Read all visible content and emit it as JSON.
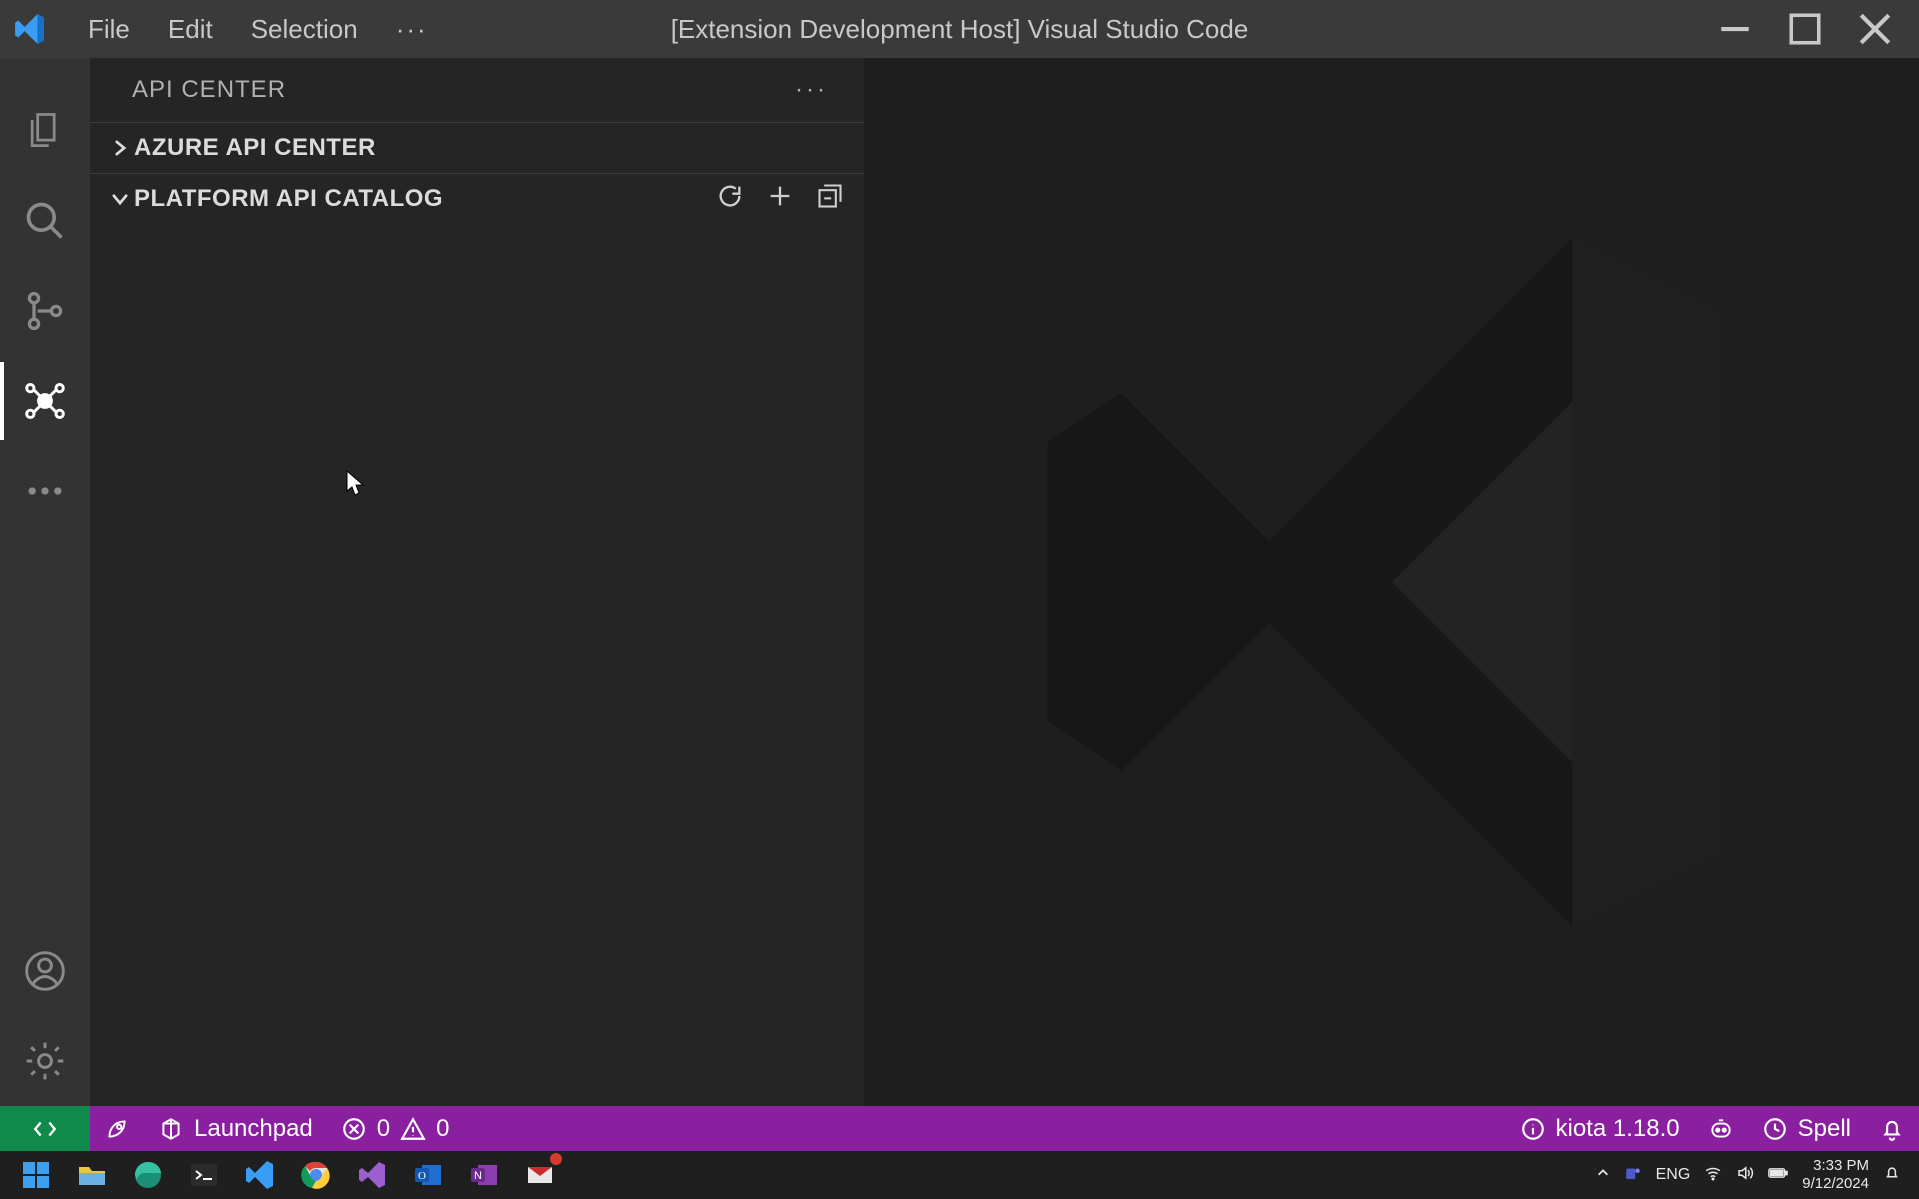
{
  "titlebar": {
    "menus": [
      "File",
      "Edit",
      "Selection"
    ],
    "overflow": "···",
    "title": "[Extension Development Host] Visual Studio Code"
  },
  "activitybar": {
    "top": [
      {
        "name": "explorer-icon",
        "active": false
      },
      {
        "name": "search-icon",
        "active": false
      },
      {
        "name": "source-control-icon",
        "active": false
      },
      {
        "name": "api-center-icon",
        "active": true
      },
      {
        "name": "more-icon",
        "active": false
      }
    ],
    "bottom": [
      {
        "name": "account-icon"
      },
      {
        "name": "settings-gear-icon"
      }
    ]
  },
  "sidebar": {
    "title": "API CENTER",
    "sections": [
      {
        "label": "AZURE API CENTER",
        "expanded": false
      },
      {
        "label": "PLATFORM API CATALOG",
        "expanded": true,
        "actions": [
          "refresh-icon",
          "add-icon",
          "collapse-all-icon"
        ]
      }
    ]
  },
  "statusbar": {
    "remote": "remote-indicator-icon",
    "left": [
      {
        "icon": "rocket-icon"
      },
      {
        "icon": "launchpad-icon",
        "text": "Launchpad"
      },
      {
        "icon": "error-icon",
        "text": "0"
      },
      {
        "icon": "warning-icon",
        "text": "0"
      }
    ],
    "right": [
      {
        "icon": "info-icon",
        "text": "kiota 1.18.0"
      },
      {
        "icon": "copilot-icon"
      },
      {
        "icon": "history-icon",
        "text": "Spell"
      },
      {
        "icon": "bell-icon"
      }
    ]
  },
  "taskbar": {
    "apps": [
      "windows-start-icon",
      "file-explorer-icon",
      "edge-icon",
      "terminal-icon",
      "vscode-icon",
      "chrome-icon",
      "visual-studio-icon",
      "outlook-icon",
      "onenote-icon",
      "mail-icon"
    ],
    "tray": {
      "lang": "ENG",
      "time": "3:33 PM",
      "date": "9/12/2024"
    }
  },
  "window_controls": [
    "minimize",
    "maximize",
    "close"
  ]
}
